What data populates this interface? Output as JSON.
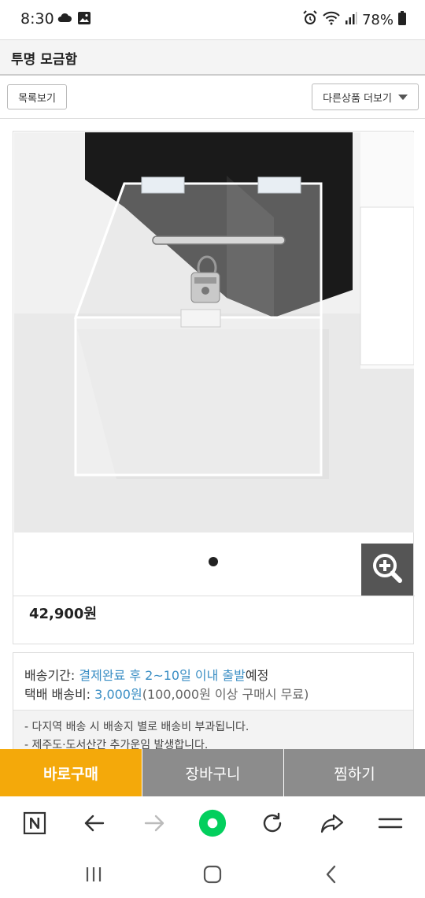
{
  "status_bar": {
    "time": "8:30",
    "battery": "78%",
    "icons": [
      "cloud-icon",
      "gallery-icon",
      "alarm-icon",
      "wifi-icon",
      "signal-icon",
      "battery-icon"
    ]
  },
  "header": {
    "title": "투명 모금함"
  },
  "toolbar": {
    "list_label": "목록보기",
    "more_label": "다른상품 더보기"
  },
  "product": {
    "image_alt": "투명 아크릴 모금함",
    "image_pages_total": 1,
    "image_page_current": 1,
    "price": "42,900원"
  },
  "shipping": {
    "period_label": "배송기간:",
    "period_value": "결제완료 후 2~10일 이내 출발",
    "period_suffix": "예정",
    "fee_label": "택배 배송비:",
    "fee_value": "3,000원",
    "fee_note": "(100,000원 이상 구매시 무료)",
    "notes": [
      "- 다지역 배송 시 배송지 별로 배송비 부과됩니다.",
      "- 제주도·도서산간 추가운임 발생합니다."
    ]
  },
  "actions": {
    "buy_now": "바로구매",
    "cart": "장바구니",
    "wishlist": "찜하기"
  },
  "colors": {
    "buy_now_bg": "#f4a90a",
    "secondary_btn_bg": "#8c8c8c",
    "link_blue": "#3a8ec4",
    "naver_green": "#03cf5d"
  }
}
